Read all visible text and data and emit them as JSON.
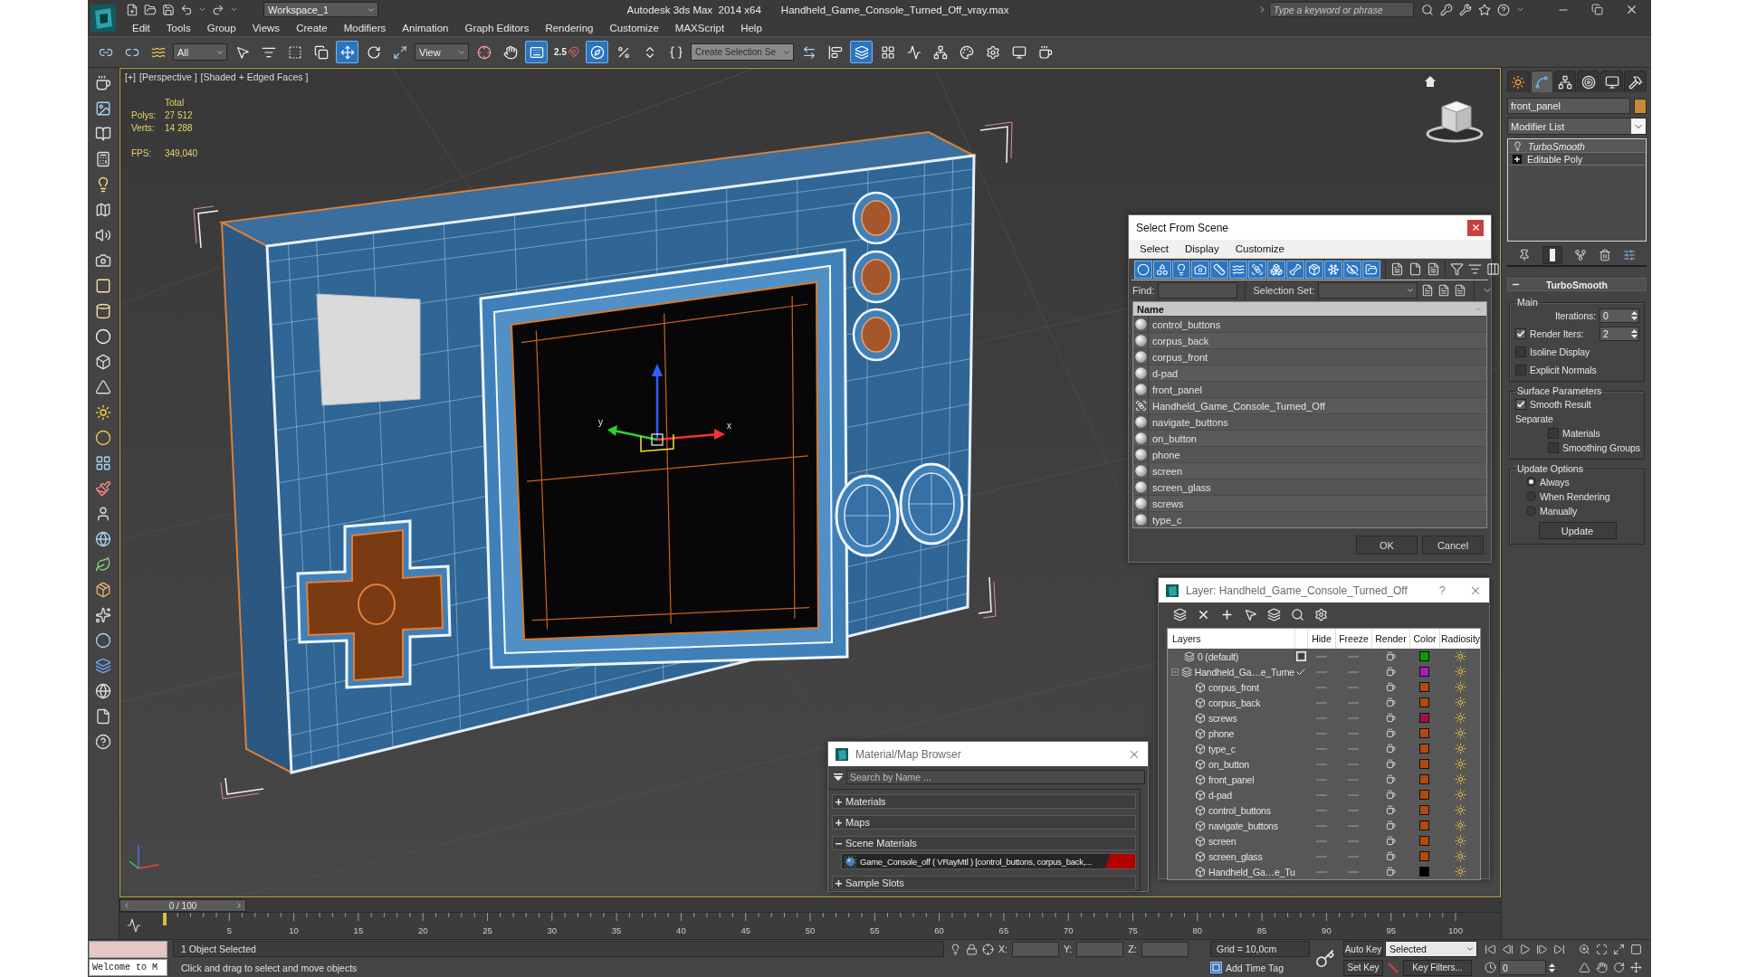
{
  "title_bar": {
    "workspace": "Workspace_1",
    "app_title": "Autodesk 3ds Max  2014 x64",
    "file_name": "Handheld_Game_Console_Turned_Off_vray.max",
    "search": {
      "placeholder": "Type a keyword or phrase"
    }
  },
  "menu": [
    "Edit",
    "Tools",
    "Group",
    "Views",
    "Create",
    "Modifiers",
    "Animation",
    "Graph Editors",
    "Rendering",
    "Customize",
    "MAXScript",
    "Help"
  ],
  "toolbar": {
    "tools": [
      {
        "kind": "link",
        "active": false
      },
      {
        "kind": "unlink",
        "active": false
      },
      {
        "kind": "bind",
        "active": false
      },
      {
        "kind": "filter_dropdown",
        "value": "All"
      },
      {
        "kind": "select",
        "active": false
      },
      {
        "kind": "select_by_name",
        "active": false
      },
      {
        "kind": "region_select",
        "active": false
      },
      {
        "kind": "window_crossing",
        "active": false
      },
      {
        "kind": "move",
        "active": true
      },
      {
        "kind": "rotate",
        "active": false
      },
      {
        "kind": "scale",
        "active": false
      },
      {
        "kind": "coordinate_dropdown",
        "value": "View"
      },
      {
        "kind": "pivot",
        "active": false
      },
      {
        "kind": "manipulate",
        "active": false
      },
      {
        "kind": "keyboard_override",
        "active": true
      },
      {
        "kind": "snaps",
        "label": "2.5",
        "active": false
      },
      {
        "kind": "angle_snap",
        "active": true
      },
      {
        "kind": "percent_snap",
        "active": false
      },
      {
        "kind": "spinner_snap",
        "active": false
      },
      {
        "kind": "named_sets",
        "active": false
      },
      {
        "kind": "selection_set_field",
        "placeholder": "Create Selection Se"
      },
      {
        "kind": "mirror",
        "active": false
      },
      {
        "kind": "align",
        "active": false
      },
      {
        "kind": "layer_explorer",
        "active": true
      },
      {
        "kind": "ribbon",
        "active": false
      },
      {
        "kind": "curve_editor",
        "active": false
      },
      {
        "kind": "schematic_view",
        "active": false
      },
      {
        "kind": "material_editor",
        "active": false
      },
      {
        "kind": "render_setup",
        "active": false
      },
      {
        "kind": "frame_window",
        "active": false
      },
      {
        "kind": "render",
        "active": false
      }
    ]
  },
  "viewport": {
    "active": true,
    "labels": [
      "[+]",
      "[Perspective ]",
      "[Shaded + Edged Faces ]"
    ],
    "stats": {
      "title": "Total",
      "rows": [
        {
          "label": "Polys:",
          "value": "27 512"
        },
        {
          "label": "Verts:",
          "value": "14 288"
        }
      ],
      "fps": {
        "label": "FPS:",
        "value": "349,040"
      }
    },
    "gizmo_labels": [
      "y",
      "x"
    ]
  },
  "select_from_scene": {
    "title": "Select From Scene",
    "menus": [
      "Select",
      "Display",
      "Customize"
    ],
    "filters": [
      {
        "kind": "geometry",
        "active": true
      },
      {
        "kind": "shapes",
        "active": true
      },
      {
        "kind": "lights",
        "active": true
      },
      {
        "kind": "cameras",
        "active": true
      },
      {
        "kind": "helpers",
        "active": true
      },
      {
        "kind": "space_warps",
        "active": true
      },
      {
        "kind": "groups",
        "active": true
      },
      {
        "kind": "xrefs",
        "active": true
      },
      {
        "kind": "bones",
        "active": true
      },
      {
        "kind": "containers",
        "active": true
      },
      {
        "kind": "frozen",
        "active": true
      },
      {
        "kind": "hidden",
        "active": true
      },
      {
        "kind": "children",
        "active": true
      }
    ],
    "find_label": "Find:",
    "selection_set_label": "Selection Set:",
    "column": "Name",
    "rows": [
      {
        "name": "control_buttons",
        "kind": "object",
        "selected": false
      },
      {
        "name": "corpus_back",
        "kind": "object",
        "selected": false
      },
      {
        "name": "corpus_front",
        "kind": "object",
        "selected": false
      },
      {
        "name": "d-pad",
        "kind": "object",
        "selected": false
      },
      {
        "name": "front_panel",
        "kind": "object",
        "selected": false
      },
      {
        "name": "Handheld_Game_Console_Turned_Off",
        "kind": "group",
        "selected": false
      },
      {
        "name": "navigate_buttons",
        "kind": "object",
        "selected": false
      },
      {
        "name": "on_button",
        "kind": "object",
        "selected": false
      },
      {
        "name": "phone",
        "kind": "object",
        "selected": false
      },
      {
        "name": "screen",
        "kind": "object",
        "selected": false
      },
      {
        "name": "screen_glass",
        "kind": "object",
        "selected": false
      },
      {
        "name": "screws",
        "kind": "object",
        "selected": false
      },
      {
        "name": "type_c",
        "kind": "object",
        "selected": false
      }
    ],
    "buttons": [
      "OK",
      "Cancel"
    ]
  },
  "layer_manager": {
    "title": "Layer: Handheld_Game_Console_Turned_Off",
    "help": "?",
    "columns": [
      "Layers",
      "Hide",
      "Freeze",
      "Render",
      "Color",
      "Radiosity"
    ],
    "layers": [
      {
        "name": "0 (default)",
        "current": false,
        "hidden": false,
        "frozen": false,
        "renderable": true,
        "radiosity": true,
        "color": "#00a000"
      },
      {
        "name": "Handheld_Ga…e_Turne",
        "current": true,
        "expanded": true,
        "hidden": false,
        "frozen": false,
        "renderable": true,
        "radiosity": true,
        "color": "#a020c0",
        "children": [
          {
            "name": "corpus_front",
            "hidden": false,
            "frozen": false,
            "renderable": true,
            "radiosity": true,
            "color": "#b04a0c"
          },
          {
            "name": "corpus_back",
            "hidden": false,
            "frozen": false,
            "renderable": true,
            "radiosity": true,
            "color": "#b04a0c"
          },
          {
            "name": "screws",
            "hidden": false,
            "frozen": false,
            "renderable": true,
            "radiosity": true,
            "color": "#a0104c"
          },
          {
            "name": "phone",
            "hidden": false,
            "frozen": false,
            "renderable": true,
            "radiosity": true,
            "color": "#b04a0c"
          },
          {
            "name": "type_c",
            "hidden": false,
            "frozen": false,
            "renderable": true,
            "radiosity": true,
            "color": "#b04a0c"
          },
          {
            "name": "on_button",
            "hidden": false,
            "frozen": false,
            "renderable": true,
            "radiosity": true,
            "color": "#b04a0c"
          },
          {
            "name": "front_panel",
            "hidden": false,
            "frozen": false,
            "renderable": true,
            "radiosity": true,
            "color": "#b04a0c"
          },
          {
            "name": "d-pad",
            "hidden": false,
            "frozen": false,
            "renderable": true,
            "radiosity": true,
            "color": "#b04a0c"
          },
          {
            "name": "control_buttons",
            "hidden": false,
            "frozen": false,
            "renderable": true,
            "radiosity": true,
            "color": "#b04a0c"
          },
          {
            "name": "navigate_buttons",
            "hidden": false,
            "frozen": false,
            "renderable": true,
            "radiosity": true,
            "color": "#b04a0c"
          },
          {
            "name": "screen",
            "hidden": false,
            "frozen": false,
            "renderable": true,
            "radiosity": true,
            "color": "#b04a0c"
          },
          {
            "name": "screen_glass",
            "hidden": false,
            "frozen": false,
            "renderable": true,
            "radiosity": true,
            "color": "#b04a0c"
          },
          {
            "name": "Handheld_Ga…e_Tu",
            "hidden": false,
            "frozen": false,
            "renderable": true,
            "radiosity": true,
            "color": "#000000"
          }
        ]
      }
    ]
  },
  "material_browser": {
    "title": "Material/Map Browser",
    "search": {
      "placeholder": "Search by Name ..."
    },
    "groups": [
      {
        "label": "Materials",
        "expanded": false
      },
      {
        "label": "Maps",
        "expanded": false
      },
      {
        "label": "Scene Materials",
        "expanded": true,
        "items": [
          "Game_Console_off ( VRayMtl ) [control_buttons, corpus_back,..."
        ]
      },
      {
        "label": "Sample Slots",
        "expanded": false
      }
    ]
  },
  "command_panel": {
    "tabs": [
      {
        "kind": "create",
        "selected": false
      },
      {
        "kind": "modify",
        "selected": true
      },
      {
        "kind": "hierarchy",
        "selected": false
      },
      {
        "kind": "motion",
        "selected": false
      },
      {
        "kind": "display",
        "selected": false
      },
      {
        "kind": "utilities",
        "selected": false
      }
    ],
    "object_name": "front_panel",
    "modifier_list": "Modifier List",
    "stack": [
      {
        "name": "TurboSmooth",
        "kind": "modifier",
        "viewport_on": false
      },
      {
        "name": "Editable Poly",
        "kind": "base_object",
        "viewport_on": true
      }
    ],
    "show_end_result": true,
    "rollout": {
      "title": "TurboSmooth",
      "expanded": true,
      "groups": [
        {
          "title": "Main",
          "items": [
            {
              "kind": "spinner",
              "label": "Iterations:",
              "value": "0"
            },
            {
              "kind": "checkbox_spinner",
              "label": "Render Iters:",
              "checked": true,
              "value": "2"
            },
            {
              "kind": "checkbox",
              "label": "Isoline Display",
              "checked": false
            },
            {
              "kind": "checkbox",
              "label": "Explicit Normals",
              "checked": false
            }
          ]
        },
        {
          "title": "Surface Parameters",
          "items": [
            {
              "kind": "checkbox",
              "label": "Smooth Result",
              "checked": true
            },
            {
              "kind": "label",
              "label": "Separate",
              "children": [
                {
                  "kind": "checkbox",
                  "label": "Materials",
                  "checked": false
                },
                {
                  "kind": "checkbox",
                  "label": "Smoothing Groups",
                  "checked": false
                }
              ]
            }
          ]
        },
        {
          "title": "Update Options",
          "items": [
            {
              "kind": "radio",
              "label": "Always",
              "selected": true
            },
            {
              "kind": "radio",
              "label": "When Rendering",
              "selected": false
            },
            {
              "kind": "radio",
              "label": "Manually",
              "selected": false
            },
            {
              "kind": "button",
              "label": "Update"
            }
          ]
        }
      ]
    }
  },
  "time_slider": {
    "label": "0 / 100",
    "level": 0
  },
  "track_bar": {
    "labels": [
      "5",
      "10",
      "15",
      "20",
      "25",
      "30",
      "35",
      "40",
      "45",
      "50",
      "55",
      "60",
      "65",
      "70",
      "75",
      "80",
      "85",
      "90",
      "95",
      "100"
    ]
  },
  "status_bar": {
    "listener_output": "Welcome to M",
    "selection": "1 Object Selected",
    "prompt": "Click and drag to select and move objects",
    "coordinates": [
      "X:",
      "Y:",
      "Z:"
    ],
    "grid": "Grid = 10,0cm",
    "time_tag": "Add Time Tag",
    "auto_key": {
      "label": "Auto Key",
      "on": false
    },
    "key_mode": "Selected",
    "set_key": "Set Key",
    "key_filters": "Key Filters...",
    "frame": "0"
  }
}
